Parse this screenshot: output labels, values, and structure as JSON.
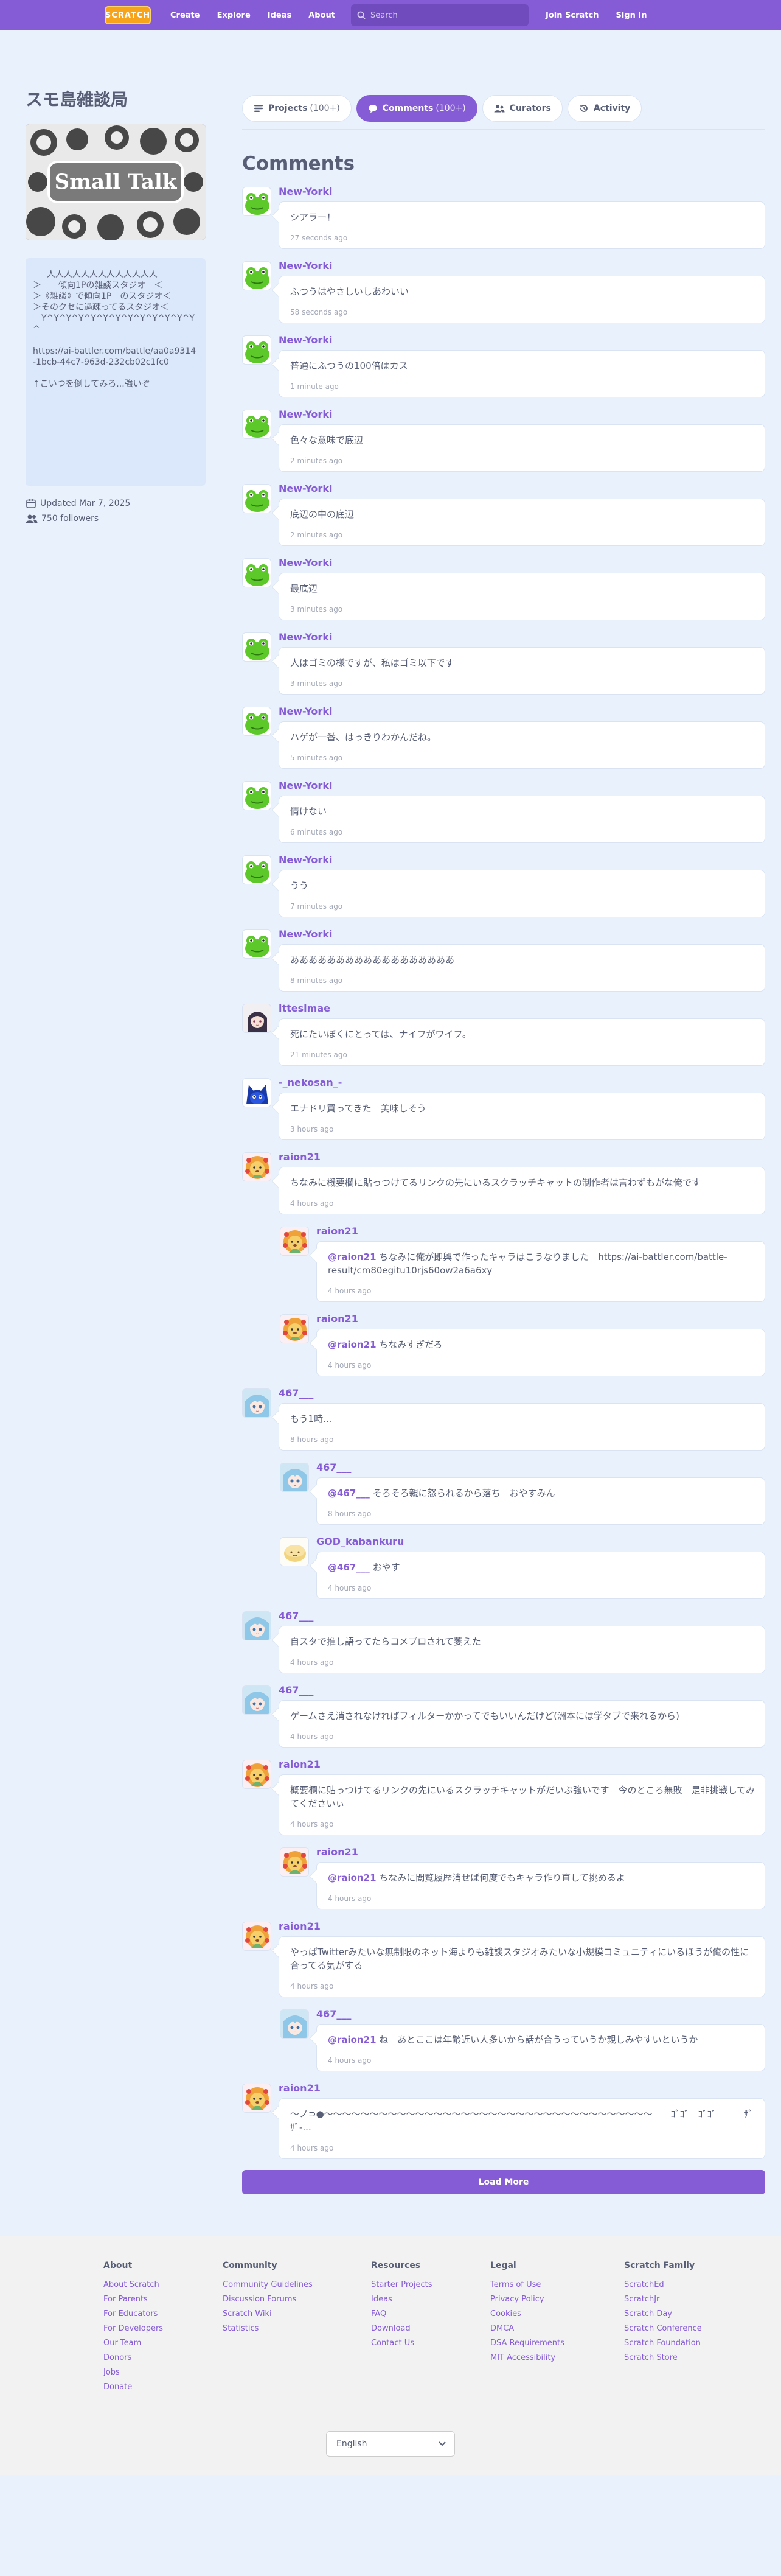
{
  "navbar": {
    "logo": "SCRATCH",
    "links": [
      "Create",
      "Explore",
      "Ideas",
      "About"
    ],
    "search_placeholder": "Search",
    "join": "Join Scratch",
    "signin": "Sign In"
  },
  "studio": {
    "title": "スモ島雑談局",
    "thumbnail_text": "Small Talk",
    "description": "  ＿人人人人人人人人人人人人人＿\n＞　　傾向1Pの雑談スタジオ　＜\n＞《雑談》で傾向1P　のスタジオ＜\n＞そのクセに過疎ってるスタジオ＜\n￣Y^Y^Y^Y^Y^Y^Y^Y^Y^Y^Y^Y^Y^￣\n\nhttps://ai-battler.com/battle/aa0a9314-1bcb-44c7-963d-232cb02c1fc0\n\n↑こいつを倒してみろ...強いぞ",
    "updated": "Updated Mar 7, 2025",
    "followers": "750 followers"
  },
  "tabs": [
    {
      "label": "Projects",
      "count": "(100+)",
      "active": false
    },
    {
      "label": "Comments",
      "count": "(100+)",
      "active": true
    },
    {
      "label": "Curators",
      "count": "",
      "active": false
    },
    {
      "label": "Activity",
      "count": "",
      "active": false
    }
  ],
  "comments_title": "Comments",
  "comments": [
    {
      "user": "New-Yorki",
      "text": "シアラー！",
      "time": "27 seconds ago",
      "reply": false,
      "av": "frog"
    },
    {
      "user": "New-Yorki",
      "text": "ふつうはやさしいしあわいい",
      "time": "58 seconds ago",
      "reply": false,
      "av": "frog"
    },
    {
      "user": "New-Yorki",
      "text": "普通にふつうの100倍はカス",
      "time": "1 minute ago",
      "reply": false,
      "av": "frog"
    },
    {
      "user": "New-Yorki",
      "text": "色々な意味で底辺",
      "time": "2 minutes ago",
      "reply": false,
      "av": "frog"
    },
    {
      "user": "New-Yorki",
      "text": "底辺の中の底辺",
      "time": "2 minutes ago",
      "reply": false,
      "av": "frog"
    },
    {
      "user": "New-Yorki",
      "text": "最底辺",
      "time": "3 minutes ago",
      "reply": false,
      "av": "frog"
    },
    {
      "user": "New-Yorki",
      "text": "人はゴミの様ですが、私はゴミ以下です",
      "time": "3 minutes ago",
      "reply": false,
      "av": "frog"
    },
    {
      "user": "New-Yorki",
      "text": "ハゲが一番、はっきりわかんだね。",
      "time": "5 minutes ago",
      "reply": false,
      "av": "frog"
    },
    {
      "user": "New-Yorki",
      "text": "情けない",
      "time": "6 minutes ago",
      "reply": false,
      "av": "frog"
    },
    {
      "user": "New-Yorki",
      "text": "うう",
      "time": "7 minutes ago",
      "reply": false,
      "av": "frog"
    },
    {
      "user": "New-Yorki",
      "text": "ああああああああああああああああああ",
      "time": "8 minutes ago",
      "reply": false,
      "av": "frog"
    },
    {
      "user": "ittesimae",
      "text": "死にたいぼくにとっては、ナイフがワイフ。",
      "time": "21 minutes ago",
      "reply": false,
      "av": "girl"
    },
    {
      "user": "-_nekosan_-",
      "text": "エナドリ買ってきた　美味しそう",
      "time": "3 hours ago",
      "reply": false,
      "av": "blue"
    },
    {
      "user": "raion21",
      "text": "ちなみに概要欄に貼っつけてるリンクの先にいるスクラッチキャットの制作者は言わずもがな俺です",
      "time": "4 hours ago",
      "reply": false,
      "av": "lion"
    },
    {
      "user": "raion21",
      "mention": "@raion21",
      "text": " ちなみに俺が即興で作ったキャラはこうなりました　https://ai-battler.com/battle-result/cm80egitu10rjs60ow2a6a6xy",
      "time": "4 hours ago",
      "reply": true,
      "av": "lion"
    },
    {
      "user": "raion21",
      "mention": "@raion21",
      "text": " ちなみすぎだろ",
      "time": "4 hours ago",
      "reply": true,
      "av": "lion"
    },
    {
      "user": "467___",
      "text": "もう1時...",
      "time": "8 hours ago",
      "reply": false,
      "av": "anime"
    },
    {
      "user": "467___",
      "mention": "@467___",
      "text": " そろそろ親に怒られるから落ち　おやすみん",
      "time": "8 hours ago",
      "reply": true,
      "av": "anime"
    },
    {
      "user": "GOD_kabankuru",
      "mention": "@467___",
      "text": " おやす",
      "time": "4 hours ago",
      "reply": true,
      "av": "bread"
    },
    {
      "user": "467___",
      "text": "自スタで推し語ってたらコメブロされて萎えた",
      "time": "4 hours ago",
      "reply": false,
      "av": "anime"
    },
    {
      "user": "467___",
      "text": "ゲームさえ消されなければフィルターかかってでもいいんだけど(洲本には学タブで来れるから)",
      "time": "4 hours ago",
      "reply": false,
      "av": "anime"
    },
    {
      "user": "raion21",
      "text": "概要欄に貼っつけてるリンクの先にいるスクラッチキャットがだいぶ強いです　今のところ無敗　是非挑戦してみてくださいぃ",
      "time": "4 hours ago",
      "reply": false,
      "av": "lion"
    },
    {
      "user": "raion21",
      "mention": "@raion21",
      "text": " ちなみに閲覧履歴消せば何度でもキャラ作り直して挑めるよ",
      "time": "4 hours ago",
      "reply": true,
      "av": "lion"
    },
    {
      "user": "raion21",
      "text": "やっぱTwitterみたいな無制限のネット海よりも雑談スタジオみたいな小規模コミュニティにいるほうが俺の性に合ってる気がする",
      "time": "4 hours ago",
      "reply": false,
      "av": "lion"
    },
    {
      "user": "467___",
      "mention": "@raion21",
      "text": " ね　あとここは年齢近い人多いから話が合うっていうか親しみやすいというか",
      "time": "4 hours ago",
      "reply": true,
      "av": "anime"
    },
    {
      "user": "raion21",
      "text": "〜ノ⊃●〜〜〜〜〜〜〜〜〜〜〜〜〜〜〜〜〜〜〜〜〜〜〜〜〜〜〜〜〜〜〜〜〜〜〜〜　　ｺﾞｺﾞ　ｺﾞｺﾞ　　　ｻﾞｻﾞ-...",
      "time": "4 hours ago",
      "reply": false,
      "av": "lion"
    }
  ],
  "load_more": "Load More",
  "footer": {
    "cols": [
      {
        "title": "About",
        "links": [
          "About Scratch",
          "For Parents",
          "For Educators",
          "For Developers",
          "Our Team",
          "Donors",
          "Jobs",
          "Donate"
        ]
      },
      {
        "title": "Community",
        "links": [
          "Community Guidelines",
          "Discussion Forums",
          "Scratch Wiki",
          "Statistics"
        ]
      },
      {
        "title": "Resources",
        "links": [
          "Starter Projects",
          "Ideas",
          "FAQ",
          "Download",
          "Contact Us"
        ]
      },
      {
        "title": "Legal",
        "links": [
          "Terms of Use",
          "Privacy Policy",
          "Cookies",
          "DMCA",
          "DSA Requirements",
          "MIT Accessibility"
        ]
      },
      {
        "title": "Scratch Family",
        "links": [
          "ScratchEd",
          "ScratchJr",
          "Scratch Day",
          "Scratch Conference",
          "Scratch Foundation",
          "Scratch Store"
        ]
      }
    ],
    "language": "English"
  }
}
